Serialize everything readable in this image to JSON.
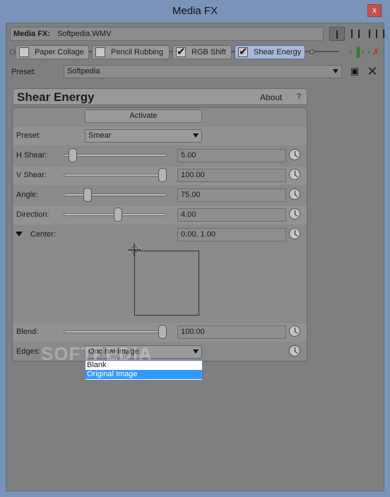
{
  "window": {
    "title": "Media FX",
    "close": "x"
  },
  "top": {
    "label": "Media FX:",
    "file": "Softpedia.WMV"
  },
  "chain": {
    "plugins": [
      {
        "label": "Paper Collage",
        "checked": false,
        "active": false
      },
      {
        "label": "Pencil Rubbing",
        "checked": false,
        "active": false
      },
      {
        "label": "RGB Shift",
        "checked": true,
        "active": false
      },
      {
        "label": "Shear Energy",
        "checked": true,
        "active": true
      }
    ]
  },
  "preset": {
    "label": "Preset:",
    "value": "Softpedia"
  },
  "plugin": {
    "title": "Shear Energy",
    "about": "About",
    "help": "?"
  },
  "panel": {
    "activate": "Activate",
    "preset_label": "Preset:",
    "preset_value": "Smear",
    "params": [
      {
        "label": "H Shear:",
        "value": "5.00",
        "level": 0.05
      },
      {
        "label": "V Shear:",
        "value": "100.00",
        "level": 1.0
      },
      {
        "label": "Angle:",
        "value": "75.00",
        "level": 0.21
      },
      {
        "label": "Direction:",
        "value": "4.00",
        "level": 0.53
      }
    ],
    "center_label": "Center:",
    "center_value": "0.00, 1.00",
    "blend_label": "Blend:",
    "blend_value": "100.00",
    "blend_level": 1.0,
    "edges_label": "Edges:",
    "edges_value": "Original Image",
    "edges_options": [
      "Blank",
      "Original Image"
    ]
  },
  "watermark": "SOFTPEDIA",
  "colors": {
    "accent": "#3399ff",
    "background": "#7f7f7f",
    "frame": "#7b93b8"
  }
}
